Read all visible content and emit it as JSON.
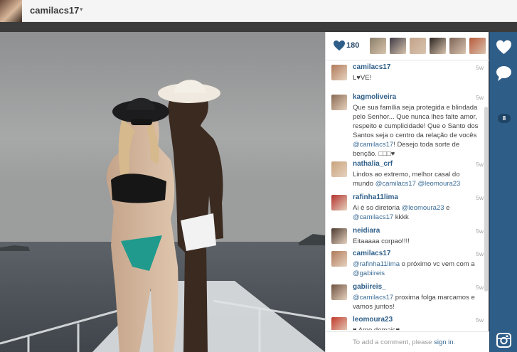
{
  "header": {
    "username": "camilacs17",
    "caret": "▾"
  },
  "post": {
    "likes_count": "180",
    "add_comment": {
      "prefix": "To add a comment, please ",
      "link": "sign in",
      "suffix": "."
    },
    "comments_badge": "8",
    "comments": [
      {
        "user": "camilacs17",
        "time": "5w",
        "avatar_color": "#b07a5a",
        "parts": [
          {
            "t": "L♥VE!"
          }
        ]
      },
      {
        "user": "kagmoliveira",
        "time": "5w",
        "avatar_color": "#8a6a52",
        "parts": [
          {
            "t": "Que sua família seja protegida e blindada pelo Senhor... Que nunca lhes falte amor, respeito e cumplicidade! Que o Santo dos Santos seja o centro da relação de vocês "
          },
          {
            "m": "@camilacs17"
          },
          {
            "t": "! Desejo toda sorte de benção. □□□♥"
          }
        ]
      },
      {
        "user": "nathalia_crf",
        "time": "5w",
        "avatar_color": "#c9a37d",
        "parts": [
          {
            "t": "Lindos ao extremo, melhor casal do mundo "
          },
          {
            "m": "@camilacs17"
          },
          {
            "t": " "
          },
          {
            "m": "@leomoura23"
          }
        ]
      },
      {
        "user": "rafinha11lima",
        "time": "5w",
        "avatar_color": "#b3322e",
        "parts": [
          {
            "t": "Ai é so diretoria "
          },
          {
            "m": "@leomoura23"
          },
          {
            "t": " e "
          },
          {
            "m": "@camilacs17"
          },
          {
            "t": " kkkk"
          }
        ]
      },
      {
        "user": "neidiara",
        "time": "5w",
        "avatar_color": "#4d3a30",
        "parts": [
          {
            "t": "Eitaaaaa corpao!!!!"
          }
        ]
      },
      {
        "user": "camilacs17",
        "time": "5w",
        "avatar_color": "#b07a5a",
        "parts": [
          {
            "m": "@rafinha11lima"
          },
          {
            "t": " o próximo vc vem com a "
          },
          {
            "m": "@gabiireis"
          }
        ]
      },
      {
        "user": "gabiireis_",
        "time": "5w",
        "avatar_color": "#6e5240",
        "parts": [
          {
            "m": "@camilacs17"
          },
          {
            "t": " proxima folga marcamos e vamos juntos!"
          }
        ]
      },
      {
        "user": "leomoura23",
        "time": "5w",
        "avatar_color": "#c0392b",
        "parts": [
          {
            "t": "♥ Amo demais♥"
          }
        ]
      }
    ],
    "likers": [
      {
        "color": "#8a7f6a"
      },
      {
        "color": "#3d3a45"
      },
      {
        "color": "#c2a289"
      },
      {
        "color": "#2b2420"
      },
      {
        "color": "#7d6458"
      },
      {
        "color": "#b85a3c"
      }
    ]
  },
  "colors": {
    "link_blue": "#2f5f89",
    "rail_blue": "#2e5d87",
    "heart": "#2f5f89"
  },
  "icons": {
    "like": "heart-icon",
    "comment": "speech-bubble-icon",
    "camera": "instagram-camera-icon",
    "dropdown": "chevron-down-icon"
  }
}
